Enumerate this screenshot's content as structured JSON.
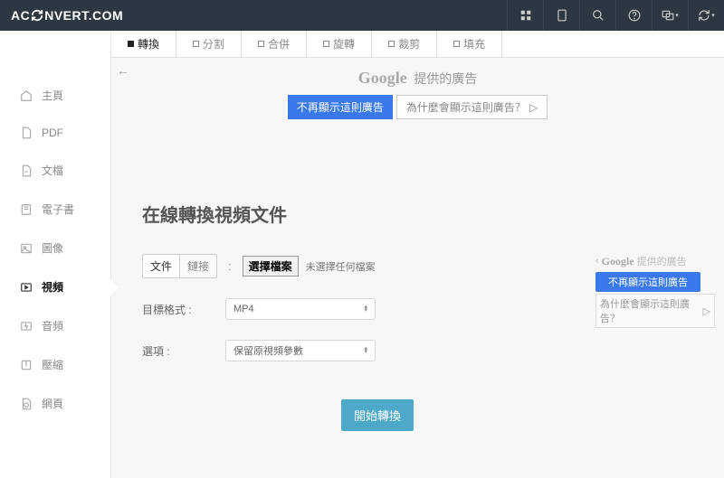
{
  "brand": {
    "pre": "AC",
    "post": "NVERT.COM"
  },
  "sidebar": {
    "items": [
      {
        "label": "主頁"
      },
      {
        "label": "PDF"
      },
      {
        "label": "文檔"
      },
      {
        "label": "電子書"
      },
      {
        "label": "圖像"
      },
      {
        "label": "視頻"
      },
      {
        "label": "音頻"
      },
      {
        "label": "壓縮"
      },
      {
        "label": "網頁"
      }
    ]
  },
  "tabs": [
    "轉換",
    "分割",
    "合併",
    "旋轉",
    "裁剪",
    "填充"
  ],
  "ad": {
    "google": "Google",
    "suffix": "提供的廣告",
    "hide": "不再顯示這則廣告",
    "why": "為什麼會顯示這則廣告？"
  },
  "page": {
    "title": "在線轉換視頻文件",
    "src": {
      "file": "文件",
      "url": "鏈接",
      "choose": "選擇檔案",
      "none": "未選擇任何檔案"
    },
    "target_label": "目標格式",
    "target_value": "MP4",
    "opts_label": "選項",
    "opts_value": "保留原視頻參數",
    "start": "開始轉換"
  },
  "side_ad": {
    "hide": "不再顯示這則廣告",
    "why": "為什麼會顯示這則廣告？"
  }
}
